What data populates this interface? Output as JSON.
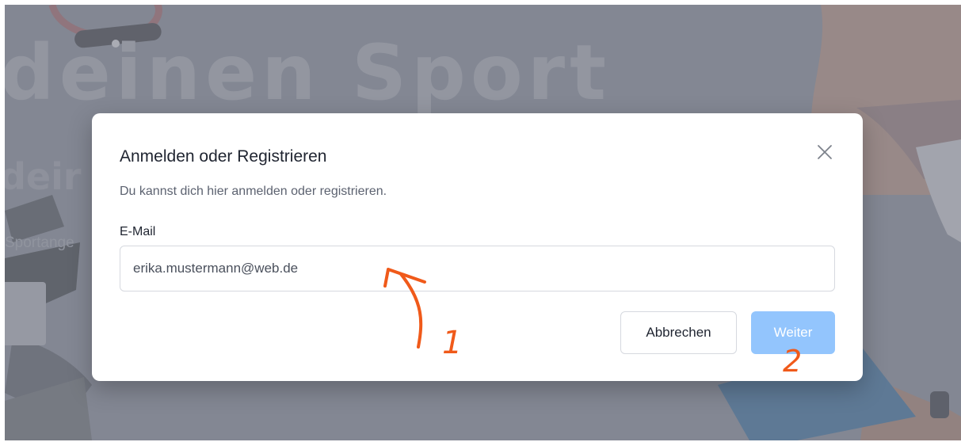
{
  "background": {
    "hero_title": "deinen Sport",
    "hero_subtitle": "deir",
    "hero_text": "Sportange"
  },
  "modal": {
    "title": "Anmelden oder Registrieren",
    "description": "Du kannst dich hier anmelden oder registrieren.",
    "email_label": "E-Mail",
    "email_value": "erika.mustermann@web.de",
    "close_icon": "close-icon",
    "cancel_label": "Abbrechen",
    "next_label": "Weiter"
  },
  "annotations": {
    "marker_1": "1",
    "marker_2": "2",
    "color": "#f05a1a"
  },
  "colors": {
    "primary_button": "#93c5fd",
    "overlay": "#9ea2ad"
  }
}
